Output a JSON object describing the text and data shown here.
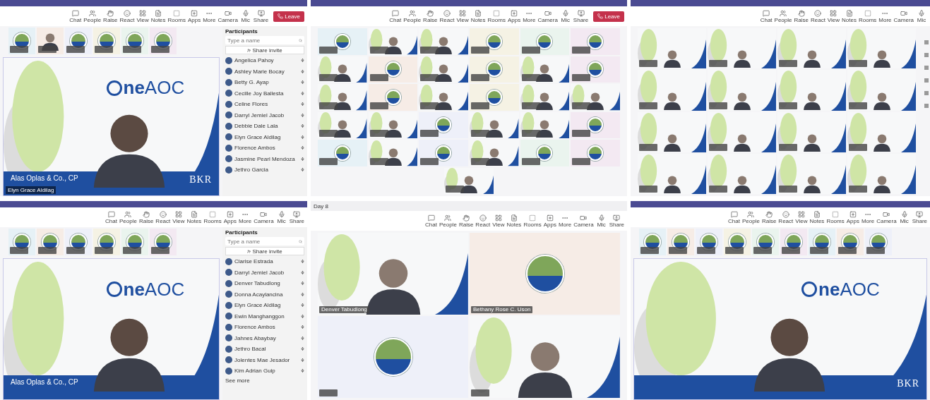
{
  "panels": [
    {
      "kind": "speaker",
      "dark_title_bar": true,
      "toolbar": [
        "Chat",
        "People",
        "Raise",
        "React",
        "View",
        "Notes",
        "Rooms",
        "Apps",
        "More",
        "Camera",
        "Mic",
        "Share"
      ],
      "leave": "Leave",
      "thumbnails": [
        {
          "kind": "avatar"
        },
        {
          "kind": "video"
        },
        {
          "kind": "avatar"
        },
        {
          "kind": "avatar"
        },
        {
          "kind": "avatar"
        },
        {
          "kind": "avatar"
        }
      ],
      "stage": {
        "logo": "**ne**AOC",
        "firm": "Alas Oplas & Co., CP",
        "brand": "BKR",
        "speaker": "Elyn Grace Aldilag"
      },
      "participants": {
        "title": "Participants",
        "placeholder": "Type a name",
        "invite": "Share invite",
        "people": [
          "Angelica Pahoy",
          "Ashley Marie Bocay",
          "Betty G. Ayap",
          "Cecille Joy Ballesta",
          "Celine Flores",
          "Darryl Jemiel Jacob",
          "Debbie Dale Lala",
          "Elyn Grace Aldilag",
          "Florence Ambos",
          "Jasmine Pearl Mendoza",
          "Jethro Garcia"
        ]
      }
    },
    {
      "kind": "gallery",
      "dark_title_bar": true,
      "toolbar": [
        "Chat",
        "People",
        "Raise",
        "React",
        "View",
        "Notes",
        "Rooms",
        "Apps",
        "More",
        "Camera",
        "Mic",
        "Share"
      ],
      "leave": "Leave",
      "rows": [
        [
          {
            "kind": "avatar"
          },
          {
            "kind": "video"
          },
          {
            "kind": "video"
          },
          {
            "kind": "avatar"
          },
          {
            "kind": "avatar"
          },
          {
            "kind": "avatar"
          }
        ],
        [
          {
            "kind": "video"
          },
          {
            "kind": "avatar"
          },
          {
            "kind": "video"
          },
          {
            "kind": "avatar"
          },
          {
            "kind": "video"
          },
          {
            "kind": "avatar"
          }
        ],
        [
          {
            "kind": "video"
          },
          {
            "kind": "avatar"
          },
          {
            "kind": "video"
          },
          {
            "kind": "avatar"
          },
          {
            "kind": "video"
          },
          {
            "kind": "video"
          }
        ],
        [
          {
            "kind": "video"
          },
          {
            "kind": "video"
          },
          {
            "kind": "avatar"
          },
          {
            "kind": "video"
          },
          {
            "kind": "video"
          },
          {
            "kind": "avatar"
          }
        ],
        [
          {
            "kind": "avatar"
          },
          {
            "kind": "video"
          },
          {
            "kind": "avatar"
          },
          {
            "kind": "video"
          },
          {
            "kind": "avatar"
          },
          {
            "kind": "avatar"
          }
        ],
        [
          {
            "kind": "video"
          }
        ]
      ]
    },
    {
      "kind": "grid",
      "dark_title_bar": true,
      "toolbar": [
        "Chat",
        "People",
        "Raise",
        "React",
        "View",
        "Notes",
        "Rooms",
        "More",
        "Camera",
        "Mic"
      ],
      "rows": [
        [
          {
            "kind": "video"
          },
          {
            "kind": "video"
          },
          {
            "kind": "video"
          },
          {
            "kind": "video"
          }
        ],
        [
          {
            "kind": "video"
          },
          {
            "kind": "video"
          },
          {
            "kind": "video"
          },
          {
            "kind": "video"
          }
        ],
        [
          {
            "kind": "video"
          },
          {
            "kind": "video"
          },
          {
            "kind": "video"
          },
          {
            "kind": "video"
          }
        ],
        [
          {
            "kind": "video"
          },
          {
            "kind": "video"
          },
          {
            "kind": "video"
          },
          {
            "kind": "video"
          }
        ]
      ]
    },
    {
      "kind": "speaker",
      "dark_title_bar": true,
      "toolbar": [
        "Chat",
        "People",
        "Raise",
        "React",
        "View",
        "Notes",
        "Rooms",
        "Apps",
        "More",
        "Camera",
        "Mic",
        "Share"
      ],
      "thumbnails": [
        {
          "kind": "avatar"
        },
        {
          "kind": "avatar"
        },
        {
          "kind": "avatar"
        },
        {
          "kind": "avatar"
        },
        {
          "kind": "avatar"
        },
        {
          "kind": "avatar"
        }
      ],
      "stage": {
        "logo": "**ne**AOC",
        "firm": "Alas Oplas & Co., CP"
      },
      "participants": {
        "title": "Participants",
        "placeholder": "Type a name",
        "invite": "Share invite",
        "people": [
          "Clarise Estrada",
          "Darryl Jemiel Jacob",
          "Denver Tabudlong",
          "Donna Acaylancina",
          "Elyn Grace Aldilag",
          "Ewin Manghanggon",
          "Florence Ambos",
          "Jahnes Abaybay",
          "Jethro Bacal",
          "Jolentes Mae Jesador",
          "Kim Adrian Guip"
        ],
        "more": "See more"
      }
    },
    {
      "kind": "grid",
      "dark_title_bar": false,
      "title": "Day 8",
      "toolbar": [
        "Chat",
        "People",
        "Raise",
        "React",
        "View",
        "Notes",
        "Rooms",
        "Apps",
        "More",
        "Camera",
        "Mic",
        "Share"
      ],
      "rows": [
        [
          {
            "kind": "video",
            "name": "Denver Tabudlong"
          },
          {
            "kind": "avatar",
            "name": "Bethany Rose C. Uson"
          }
        ],
        [
          {
            "kind": "avatar"
          },
          {
            "kind": "video"
          }
        ]
      ]
    },
    {
      "kind": "speaker",
      "dark_title_bar": true,
      "toolbar": [
        "Chat",
        "People",
        "Raise",
        "React",
        "View",
        "Notes",
        "Rooms",
        "Apps",
        "More",
        "Camera",
        "Mic",
        "Share"
      ],
      "thumbnails": [
        {
          "kind": "avatar"
        },
        {
          "kind": "avatar"
        },
        {
          "kind": "avatar"
        },
        {
          "kind": "avatar"
        },
        {
          "kind": "avatar"
        },
        {
          "kind": "avatar"
        },
        {
          "kind": "avatar"
        },
        {
          "kind": "avatar"
        },
        {
          "kind": "avatar"
        }
      ],
      "stage": {
        "logo": "**ne**AOC",
        "brand": "BKR"
      }
    }
  ]
}
